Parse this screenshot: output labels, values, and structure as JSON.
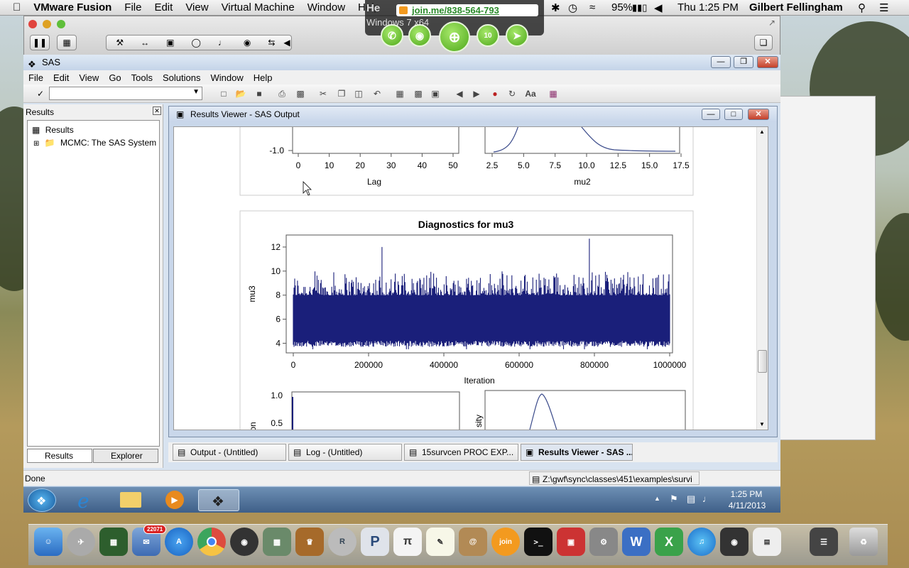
{
  "menubar": {
    "app_name": "VMware Fusion",
    "items": [
      "File",
      "Edit",
      "View",
      "Virtual Machine",
      "Window",
      "Help"
    ],
    "battery": "95%",
    "clock": "Thu 1:25 PM",
    "user": "Gilbert Fellingham"
  },
  "joinme": {
    "url": "join.me/838-564-793",
    "behind_text": "Windows 7 x64",
    "participants": "10"
  },
  "sas": {
    "window_title": "SAS",
    "menu": [
      "File",
      "Edit",
      "View",
      "Go",
      "Tools",
      "Solutions",
      "Window",
      "Help"
    ],
    "command_value": "",
    "results_pane": {
      "title": "Results",
      "tree_root": "Results",
      "tree_item": "MCMC:  The SAS System",
      "tab_results": "Results",
      "tab_explorer": "Explorer"
    },
    "viewer": {
      "title": "Results Viewer - SAS Output"
    },
    "window_tabs": [
      "Output - (Untitled)",
      "Log - (Untitled)",
      "15survcen        PROC EXP...",
      "Results Viewer - SAS ..."
    ],
    "status_left": "Done",
    "status_path": "Z:\\gwf\\sync\\classes\\451\\examples\\survi"
  },
  "top_plots": {
    "left_ytick": "-1.0",
    "left_xticks": [
      "0",
      "10",
      "20",
      "30",
      "40",
      "50"
    ],
    "left_xlabel": "Lag",
    "right_xticks": [
      "2.5",
      "5.0",
      "7.5",
      "10.0",
      "12.5",
      "15.0",
      "17.5"
    ],
    "right_xlabel": "mu2"
  },
  "chart_data": {
    "type": "line",
    "title": "Diagnostics for mu3",
    "xlabel": "Iteration",
    "ylabel": "mu3",
    "xticks": [
      "0",
      "200000",
      "400000",
      "600000",
      "800000",
      "1000000"
    ],
    "yticks": [
      "4",
      "6",
      "8",
      "10",
      "12"
    ],
    "xlim": [
      0,
      1000000
    ],
    "ylim": [
      3.2,
      13
    ],
    "series": [
      {
        "color": "#1a1f7a",
        "band_low": 4.2,
        "band_high": 8.0,
        "max_spike": 12.7,
        "min_dip": 3.5
      }
    ]
  },
  "bottom_plots": {
    "left_yticks": [
      "1.0",
      "0.5"
    ],
    "left_ylabel_partial": "on",
    "right_ylabel_partial": "sity"
  },
  "win7": {
    "clock_time": "1:25 PM",
    "clock_date": "4/11/2013"
  },
  "dock": {
    "mail_badge": "22071"
  },
  "colors": {
    "plot_series": "#1a1f7a",
    "joinme_green": "#4ea81a"
  }
}
